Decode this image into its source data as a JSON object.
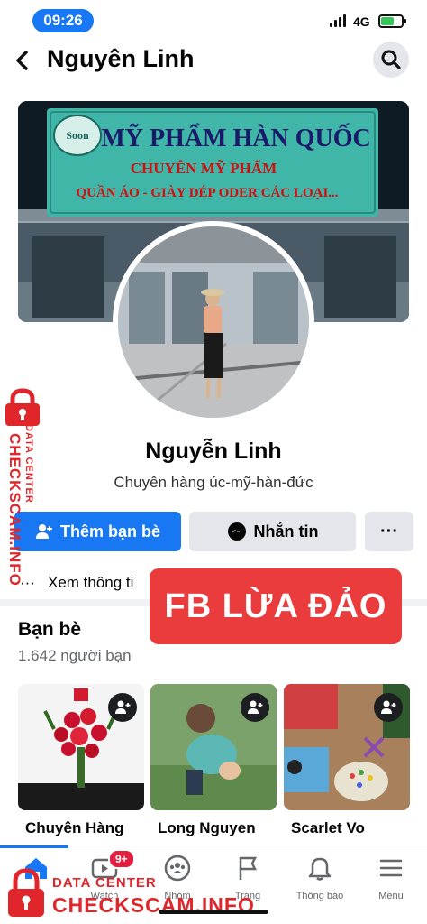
{
  "status_bar": {
    "time": "09:26",
    "network": "4G"
  },
  "header": {
    "title": "Nguyên Linh"
  },
  "cover": {
    "sign_line1": "MỸ PHẨM HÀN QUỐC",
    "sign_line2": "CHUYÊN MỸ PHẨM",
    "sign_line3": "QUẦN ÁO - GIÀY DÉP ODER CÁC LOẠI..."
  },
  "profile": {
    "name": "Nguyễn Linh",
    "bio": "Chuyên hàng úc-mỹ-hàn-đức"
  },
  "actions": {
    "add_friend": "Thêm bạn bè",
    "message": "Nhắn tin",
    "more": "···"
  },
  "about": {
    "label": "Xem thông ti"
  },
  "warning_banner": "FB LỪA ĐẢO",
  "friends": {
    "title": "Bạn bè",
    "count": "1.642 người bạn",
    "items": [
      {
        "name": "Chuyên Hàng"
      },
      {
        "name": "Long Nguyen"
      },
      {
        "name": "Scarlet Vo"
      }
    ]
  },
  "bottom_nav": {
    "items": [
      {
        "label": "tin",
        "icon": "home-icon"
      },
      {
        "label": "Watch",
        "icon": "watch-icon",
        "badge": "9+"
      },
      {
        "label": "Nhóm",
        "icon": "groups-icon"
      },
      {
        "label": "Trang",
        "icon": "flag-icon"
      },
      {
        "label": "Thông báo",
        "icon": "bell-icon"
      },
      {
        "label": "Menu",
        "icon": "menu-icon"
      }
    ]
  },
  "watermark": {
    "data_center": "DATA CENTER",
    "site": "CHECKSCAM.INFO"
  },
  "colors": {
    "accent": "#1877f2",
    "warning": "#ea3c3c",
    "watermark": "#e0262a"
  }
}
